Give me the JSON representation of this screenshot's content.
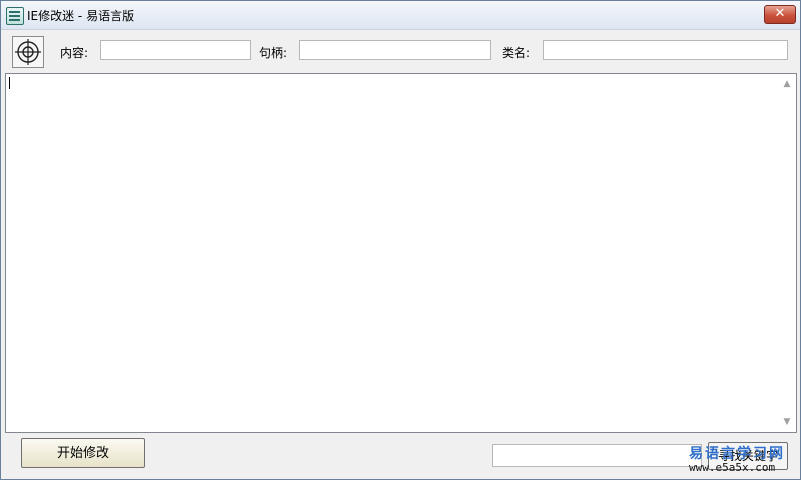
{
  "window": {
    "title": "IE修改迷 - 易语言版",
    "close_glyph": "✕"
  },
  "toolbar": {
    "content_label": "内容:",
    "content_value": "",
    "handle_label": "句柄:",
    "handle_value": "",
    "class_label": "类名:",
    "class_value": ""
  },
  "editor": {
    "text": "",
    "scroll_up_glyph": "▲",
    "scroll_down_glyph": "▼"
  },
  "footer": {
    "start_button": "开始修改",
    "search_value": "",
    "find_button": "寻找关键字"
  },
  "watermark": {
    "line1": "易语言学习网",
    "line2": "www.e5a5x.com"
  },
  "icons": {
    "app": "app-icon",
    "target": "crosshair-icon"
  }
}
